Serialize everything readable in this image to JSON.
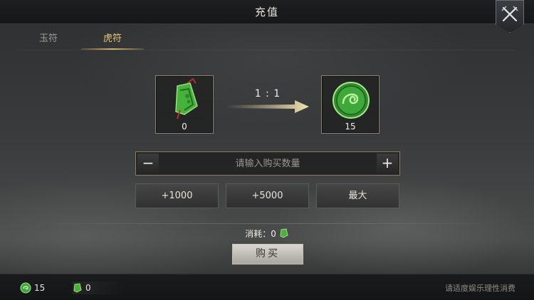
{
  "header": {
    "title": "充值"
  },
  "tabs": [
    {
      "label": "玉符"
    },
    {
      "label": "虎符"
    }
  ],
  "exchange": {
    "source_qty": "0",
    "target_qty": "15",
    "ratio": "1 : 1"
  },
  "quantity": {
    "placeholder": "请输入购买数量",
    "minus": "−",
    "plus": "+"
  },
  "quick_buttons": [
    {
      "label": "+1000"
    },
    {
      "label": "+5000"
    },
    {
      "label": "最大"
    }
  ],
  "consume": {
    "label": "消耗：",
    "value": "0"
  },
  "buy_button": {
    "label": "购买"
  },
  "footer": {
    "coin_count": "15",
    "jade_count": "0",
    "notice": "请适度娱乐理性消费"
  },
  "colors": {
    "accent": "#d6b266",
    "jade": "#3fa83a"
  }
}
